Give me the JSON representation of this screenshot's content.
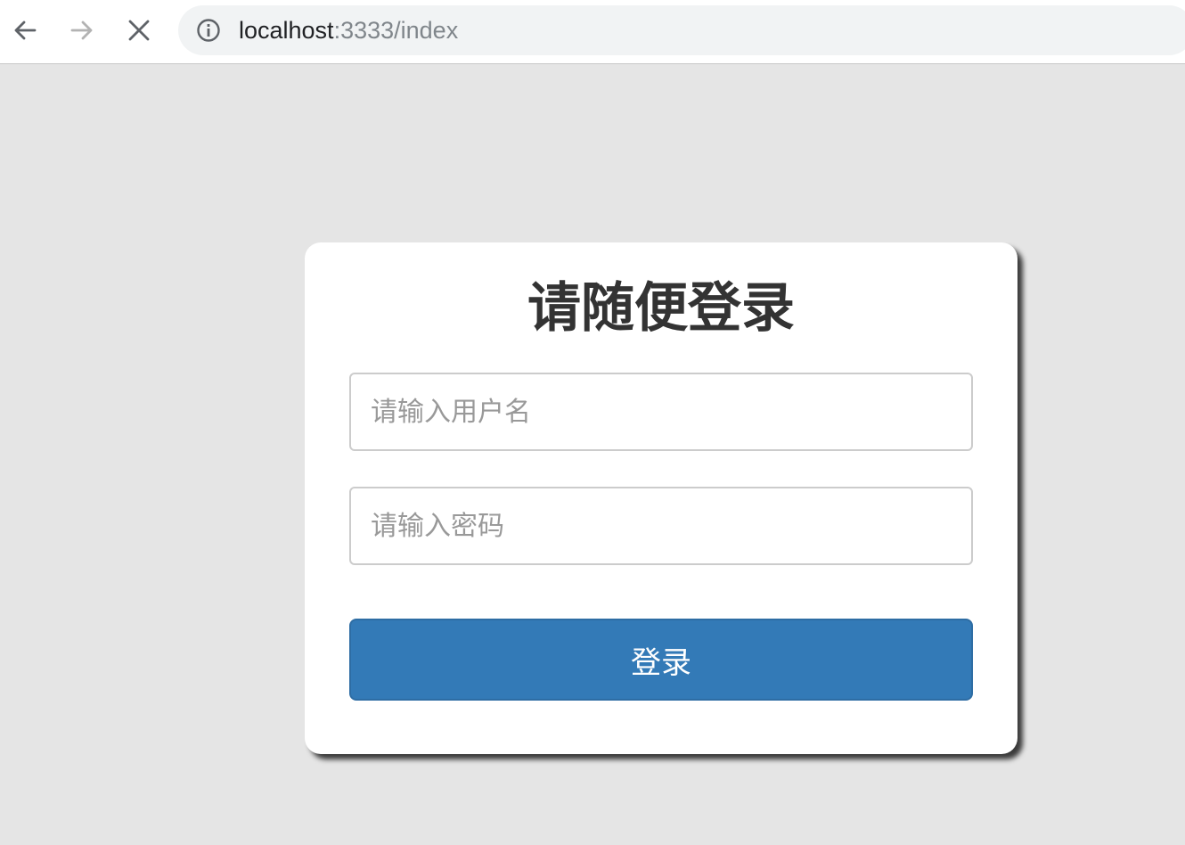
{
  "browser": {
    "url_host": "localhost",
    "url_rest": ":3333/index",
    "back_icon": "arrow-left-icon",
    "forward_icon": "arrow-right-icon",
    "stop_icon": "close-icon",
    "info_icon": "info-icon"
  },
  "login": {
    "title": "请随便登录",
    "username_placeholder": "请输入用户名",
    "username_value": "",
    "password_placeholder": "请输入密码",
    "password_value": "",
    "submit_label": "登录"
  },
  "colors": {
    "page_background": "#e5e5e5",
    "primary_button": "#337ab7",
    "title_text": "#333333",
    "placeholder_text": "#999999"
  }
}
